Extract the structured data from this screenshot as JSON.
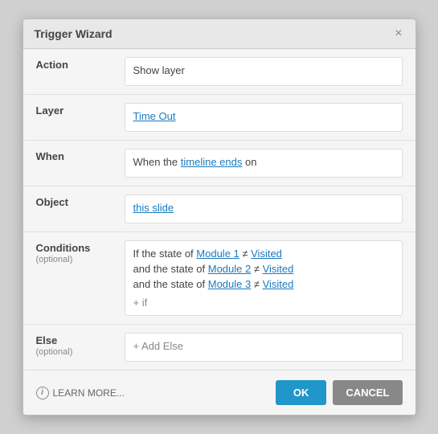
{
  "dialog": {
    "title": "Trigger Wizard",
    "close_label": "×"
  },
  "action_row": {
    "label": "Action",
    "value": "Show layer"
  },
  "layer_row": {
    "label": "Layer",
    "value": "Time Out"
  },
  "when_row": {
    "label": "When",
    "value_prefix": "When the ",
    "value_link": "timeline ends",
    "value_suffix": " on"
  },
  "object_row": {
    "label": "Object",
    "value": "this slide"
  },
  "conditions_row": {
    "label": "Conditions",
    "sublabel": "(optional)",
    "line1_prefix": "If the state of ",
    "line1_module": "Module 1",
    "line1_neq": " ≠ ",
    "line1_visited": "Visited",
    "line2_prefix": "and the state of ",
    "line2_module": "Module 2",
    "line2_neq": " ≠ ",
    "line2_visited": "Visited",
    "line3_prefix": "and the state of ",
    "line3_module": "Module 3",
    "line3_neq": " ≠ ",
    "line3_visited": "Visited",
    "add_if": "+ if"
  },
  "else_row": {
    "label": "Else",
    "sublabel": "(optional)",
    "add_else": "+ Add Else"
  },
  "footer": {
    "learn_more": "LEARN MORE...",
    "ok_label": "OK",
    "cancel_label": "CANCEL"
  }
}
